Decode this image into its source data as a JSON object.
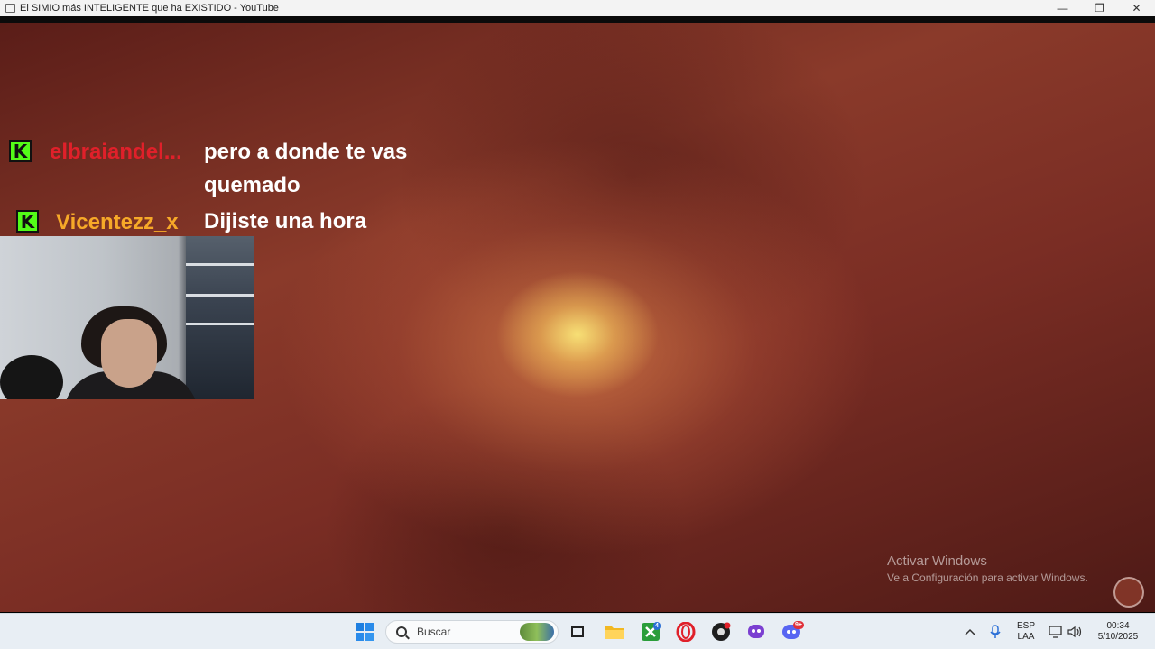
{
  "window": {
    "title": "El SIMIO más INTELIGENTE que ha EXISTIDO - YouTube",
    "minimize_glyph": "—",
    "restore_glyph": "❐",
    "close_glyph": "✕"
  },
  "chat": {
    "badge_letter": "K",
    "messages": [
      {
        "username": "elbraiandel...",
        "username_color": "#e0202a",
        "line1": "pero a donde te vas",
        "line2": "quemado"
      },
      {
        "username": "Vicentezz_x",
        "username_color": "#f7a928",
        "line1": "Dijiste una hora"
      }
    ]
  },
  "watermark": {
    "title": "Activar Windows",
    "subtitle": "Ve a Configuración para activar Windows."
  },
  "taskbar": {
    "search_placeholder": "Buscar",
    "xbox_badge": "4",
    "discord_badge": "9+",
    "language_top": "ESP",
    "language_bottom": "LAA",
    "time": "00:34",
    "date": "5/10/2025",
    "icons": [
      "windows-start-icon",
      "search-icon",
      "task-view-icon",
      "file-explorer-icon",
      "xbox-icon",
      "opera-icon",
      "obs-icon",
      "streaming-app-icon",
      "discord-icon",
      "chevron-up-icon",
      "microphone-icon",
      "display-icon",
      "speaker-icon"
    ]
  }
}
